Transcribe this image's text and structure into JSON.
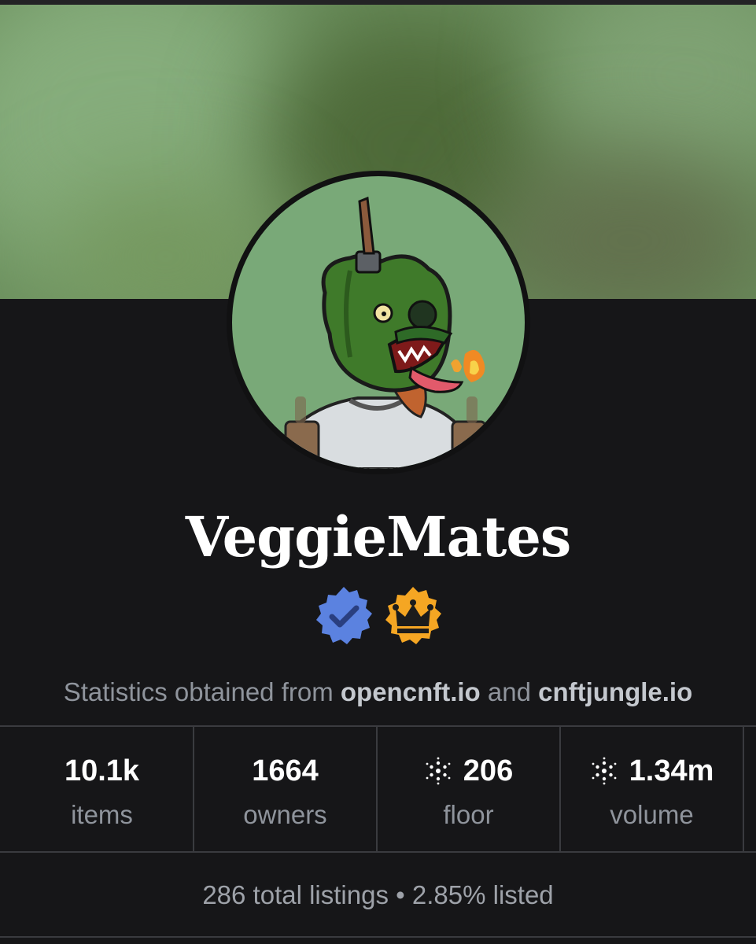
{
  "collection": {
    "name": "VeggieMates",
    "badges": [
      "verified-badge-icon",
      "crown-badge-icon"
    ]
  },
  "stats_note": {
    "prefix": "Statistics obtained from",
    "source1": "opencnft.io",
    "joiner": "and",
    "source2": "cnftjungle.io"
  },
  "stats": [
    {
      "value": "10.1k",
      "label": "items",
      "icon": ""
    },
    {
      "value": "1664",
      "label": "owners",
      "icon": ""
    },
    {
      "value": "206",
      "label": "floor",
      "icon": "cardano-ada-icon"
    },
    {
      "value": "1.34m",
      "label": "volume",
      "icon": "cardano-ada-icon"
    }
  ],
  "listing": {
    "total": "286 total listings",
    "separator": "•",
    "percent": "2.85% listed"
  },
  "colors": {
    "background": "#161618",
    "banner": "#6a8e5c",
    "avatar_bg": "#79a978",
    "verified_badge": "#5b82e0",
    "crown_badge": "#f5a623",
    "muted_text": "#8f949c",
    "divider": "#3a3b3f"
  }
}
